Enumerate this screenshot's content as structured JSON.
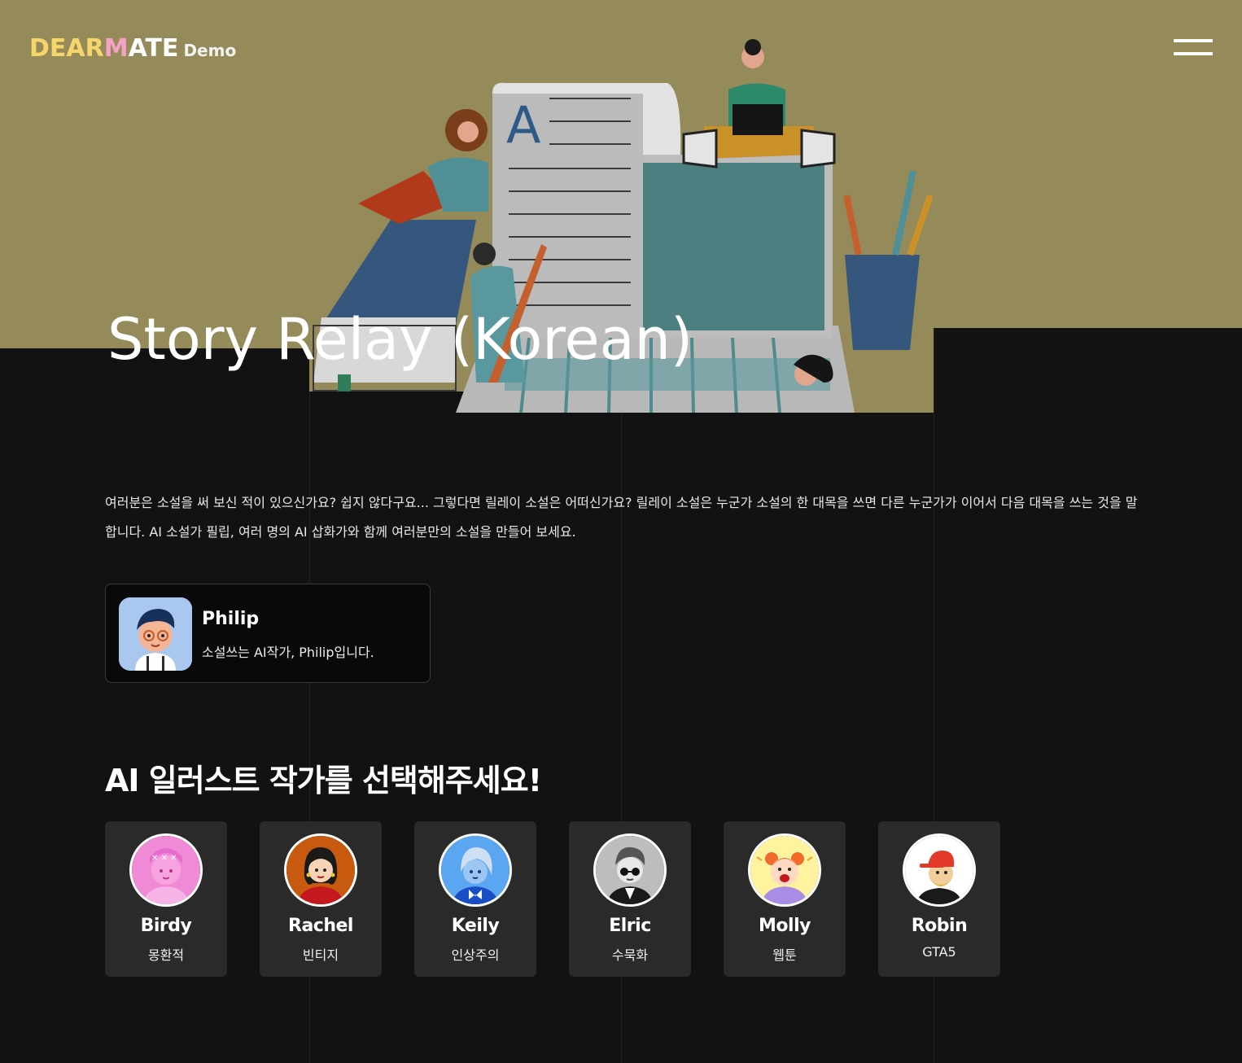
{
  "brand": {
    "logo_part1": "DEAR",
    "logo_part2": "M",
    "logo_part3": "ATE",
    "demo_label": "Demo"
  },
  "header": {
    "menu_icon": "hamburger-menu-icon"
  },
  "hero": {
    "title": "Story Relay (Korean)",
    "illustration": "writers-workspace-illustration",
    "background_color": "#958b5a"
  },
  "intro": {
    "text": "여러분은 소설을 써 보신 적이 있으신가요? 쉽지 않다구요... 그렇다면 릴레이 소설은 어떠신가요? 릴레이 소설은 누군가 소설의 한 대목을 쓰면 다른 누군가가 이어서 다음 대목을 쓰는 것을 말합니다. AI 소설가 필립, 여러 명의 AI 삽화가와 함께 여러분만의 소설을 만들어 보세요."
  },
  "author": {
    "name": "Philip",
    "description": "소설쓰는 AI작가, Philip입니다."
  },
  "section": {
    "title": "AI 일러스트 작가를 선택해주세요!"
  },
  "artists": [
    {
      "name": "Birdy",
      "style": "몽환적",
      "avatar_color": "#f08ad6"
    },
    {
      "name": "Rachel",
      "style": "빈티지",
      "avatar_color": "#c85a10"
    },
    {
      "name": "Keily",
      "style": "인상주의",
      "avatar_color": "#5aa6f0"
    },
    {
      "name": "Elric",
      "style": "수묵화",
      "avatar_color": "#bdbdbd"
    },
    {
      "name": "Molly",
      "style": "웹툰",
      "avatar_color": "#fff3a0"
    },
    {
      "name": "Robin",
      "style": "GTA5",
      "avatar_color": "#ffffff"
    }
  ]
}
